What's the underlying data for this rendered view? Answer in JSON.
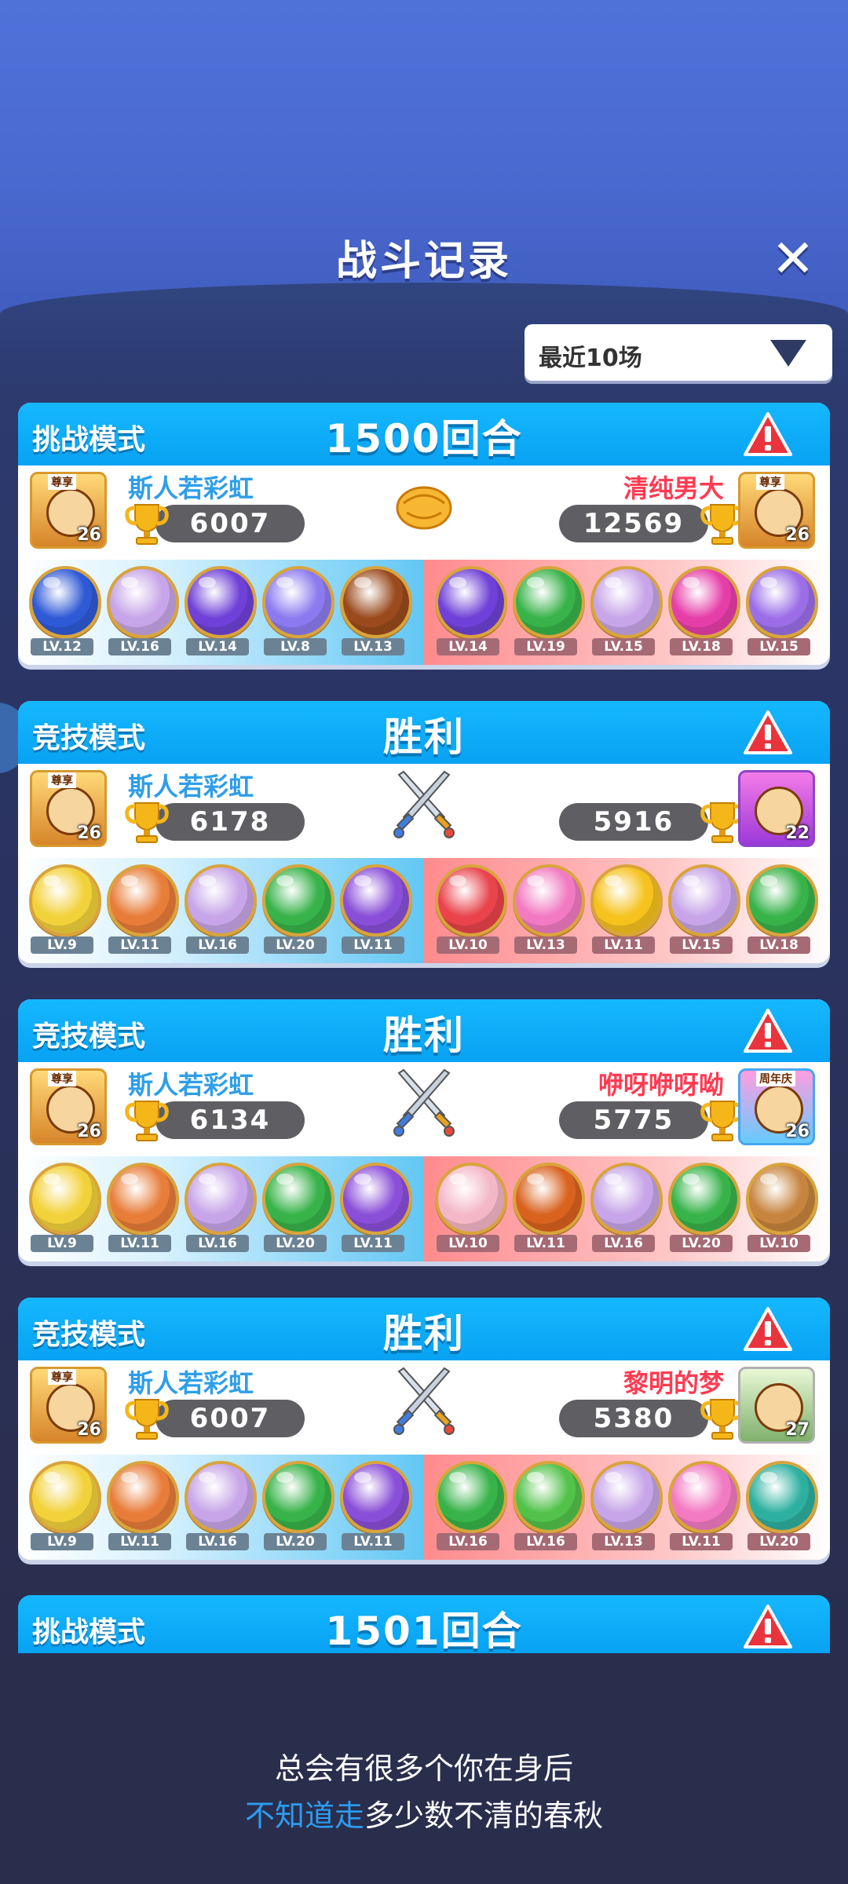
{
  "header": {
    "title": "战斗记录",
    "close_icon": "close-icon"
  },
  "filter": {
    "selected": "最近10场"
  },
  "matches": [
    {
      "mode": "挑战模式",
      "result": "1500回合",
      "vs_icon": "handshake-icon",
      "left": {
        "name": "斯人若彩虹",
        "score": "6007",
        "avatar_level": "26",
        "avatar_badge": "尊享",
        "pets": [
          {
            "lv": "LV.12",
            "color": "#2f5ad6"
          },
          {
            "lv": "LV.16",
            "color": "#c7a5e8"
          },
          {
            "lv": "LV.14",
            "color": "#6f41d8"
          },
          {
            "lv": "LV.8",
            "color": "#8c7bf0"
          },
          {
            "lv": "LV.13",
            "color": "#9a4a1d"
          }
        ]
      },
      "right": {
        "name": "清纯男大",
        "score": "12569",
        "avatar_level": "26",
        "avatar_badge": "尊享",
        "pets": [
          {
            "lv": "LV.14",
            "color": "#6f41d8"
          },
          {
            "lv": "LV.19",
            "color": "#38b34a"
          },
          {
            "lv": "LV.15",
            "color": "#c7a5e8"
          },
          {
            "lv": "LV.18",
            "color": "#e63ea8"
          },
          {
            "lv": "LV.15",
            "color": "#9b6ee8"
          }
        ]
      }
    },
    {
      "mode": "竞技模式",
      "result": "胜利",
      "vs_icon": "crossed-swords-icon",
      "left": {
        "name": "斯人若彩虹",
        "score": "6178",
        "avatar_level": "26",
        "avatar_badge": "尊享",
        "pets": [
          {
            "lv": "LV.9",
            "color": "#f2d23b"
          },
          {
            "lv": "LV.11",
            "color": "#e87d3a"
          },
          {
            "lv": "LV.16",
            "color": "#c7a5e8"
          },
          {
            "lv": "LV.20",
            "color": "#38b34a"
          },
          {
            "lv": "LV.11",
            "color": "#8a4fd8"
          }
        ]
      },
      "right": {
        "name": "",
        "score": "5916",
        "avatar_level": "22",
        "avatar_badge": "",
        "pets": [
          {
            "lv": "LV.10",
            "color": "#e9434c"
          },
          {
            "lv": "LV.13",
            "color": "#f27ac2"
          },
          {
            "lv": "LV.11",
            "color": "#f6c21e"
          },
          {
            "lv": "LV.15",
            "color": "#c7a5e8"
          },
          {
            "lv": "LV.18",
            "color": "#38b34a"
          }
        ]
      }
    },
    {
      "mode": "竞技模式",
      "result": "胜利",
      "vs_icon": "crossed-swords-icon",
      "left": {
        "name": "斯人若彩虹",
        "score": "6134",
        "avatar_level": "26",
        "avatar_badge": "尊享",
        "pets": [
          {
            "lv": "LV.9",
            "color": "#f2d23b"
          },
          {
            "lv": "LV.11",
            "color": "#e87d3a"
          },
          {
            "lv": "LV.16",
            "color": "#c7a5e8"
          },
          {
            "lv": "LV.20",
            "color": "#38b34a"
          },
          {
            "lv": "LV.11",
            "color": "#8a4fd8"
          }
        ]
      },
      "right": {
        "name": "咿呀咿呀呦",
        "score": "5775",
        "avatar_level": "26",
        "avatar_badge": "周年庆",
        "pets": [
          {
            "lv": "LV.10",
            "color": "#f4b7c8"
          },
          {
            "lv": "LV.11",
            "color": "#d9621f"
          },
          {
            "lv": "LV.16",
            "color": "#c7a5e8"
          },
          {
            "lv": "LV.20",
            "color": "#38b34a"
          },
          {
            "lv": "LV.10",
            "color": "#c7843e"
          }
        ]
      }
    },
    {
      "mode": "竞技模式",
      "result": "胜利",
      "vs_icon": "crossed-swords-icon",
      "left": {
        "name": "斯人若彩虹",
        "score": "6007",
        "avatar_level": "26",
        "avatar_badge": "尊享",
        "pets": [
          {
            "lv": "LV.9",
            "color": "#f2d23b"
          },
          {
            "lv": "LV.11",
            "color": "#e87d3a"
          },
          {
            "lv": "LV.16",
            "color": "#c7a5e8"
          },
          {
            "lv": "LV.20",
            "color": "#38b34a"
          },
          {
            "lv": "LV.11",
            "color": "#8a4fd8"
          }
        ]
      },
      "right": {
        "name": "黎明的梦",
        "score": "5380",
        "avatar_level": "27",
        "avatar_badge": "",
        "pets": [
          {
            "lv": "LV.16",
            "color": "#38b34a"
          },
          {
            "lv": "LV.16",
            "color": "#52c24a"
          },
          {
            "lv": "LV.13",
            "color": "#c7a5e8"
          },
          {
            "lv": "LV.11",
            "color": "#f27ac2"
          },
          {
            "lv": "LV.20",
            "color": "#2db0a0"
          }
        ]
      }
    }
  ],
  "partial_card": {
    "mode": "挑战模式",
    "result": "1501回合"
  },
  "lyrics": {
    "line1": "总会有很多个你在身后",
    "line2_highlight": "不知道走",
    "line2_rest": "多少数不清的春秋"
  }
}
